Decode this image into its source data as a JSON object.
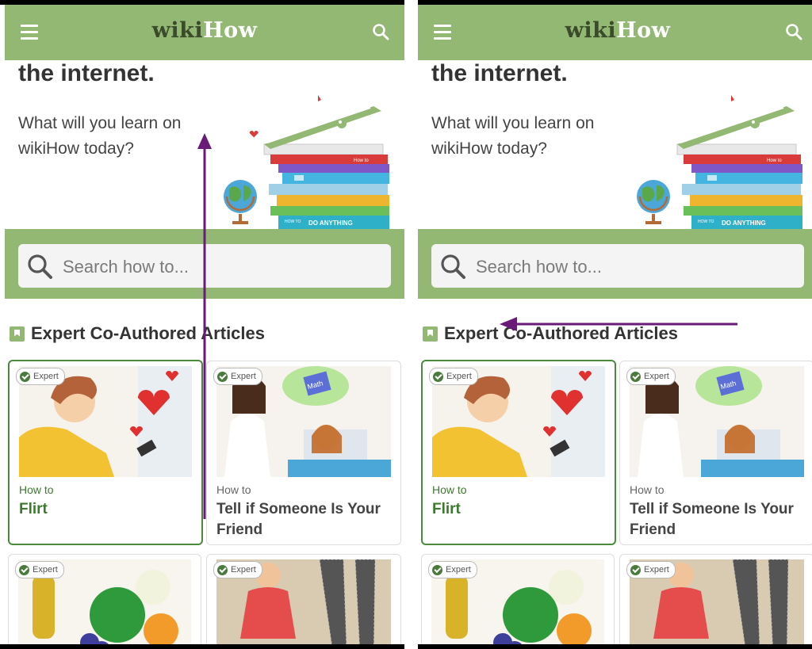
{
  "panels": [
    {
      "header": {
        "logo_part1": "wiki",
        "logo_part2": "How"
      },
      "hero": {
        "title": "the internet.",
        "subtitle": "What will you learn on wikiHow today?"
      },
      "illustration": {
        "book_label_1": "How to",
        "book_label_2": "DO ANYTHING",
        "book_label_3": "HOW TO"
      },
      "search": {
        "placeholder": "Search how to..."
      },
      "section": {
        "title": "Expert Co-Authored Articles"
      },
      "cards": [
        {
          "badge": "Expert",
          "howto": "How to",
          "title": "Flirt",
          "selected": true
        },
        {
          "badge": "Expert",
          "howto": "How to",
          "title": "Tell if Someone Is Your Friend",
          "selected": false
        },
        {
          "badge": "Expert"
        },
        {
          "badge": "Expert"
        }
      ],
      "math_book_label": "Math"
    },
    {
      "header": {
        "logo_part1": "wiki",
        "logo_part2": "How"
      },
      "hero": {
        "title": "the internet.",
        "subtitle": "What will you learn on wikiHow today?"
      },
      "illustration": {
        "book_label_1": "How to",
        "book_label_2": "DO ANYTHING",
        "book_label_3": "HOW TO"
      },
      "search": {
        "placeholder": "Search how to..."
      },
      "section": {
        "title": "Expert Co-Authored Articles"
      },
      "cards": [
        {
          "badge": "Expert",
          "howto": "How to",
          "title": "Flirt",
          "selected": true
        },
        {
          "badge": "Expert",
          "howto": "How to",
          "title": "Tell if Someone Is Your Friend",
          "selected": false
        },
        {
          "badge": "Expert"
        },
        {
          "badge": "Expert"
        }
      ],
      "math_book_label": "Math"
    }
  ],
  "gestures": [
    {
      "panel": "left",
      "direction": "up",
      "type": "swipe"
    },
    {
      "panel": "right",
      "direction": "left",
      "type": "swipe"
    }
  ],
  "colors": {
    "header_green": "#93b874",
    "selected_border": "#4a8a3c",
    "gesture_arrow": "#6a1b7a"
  }
}
